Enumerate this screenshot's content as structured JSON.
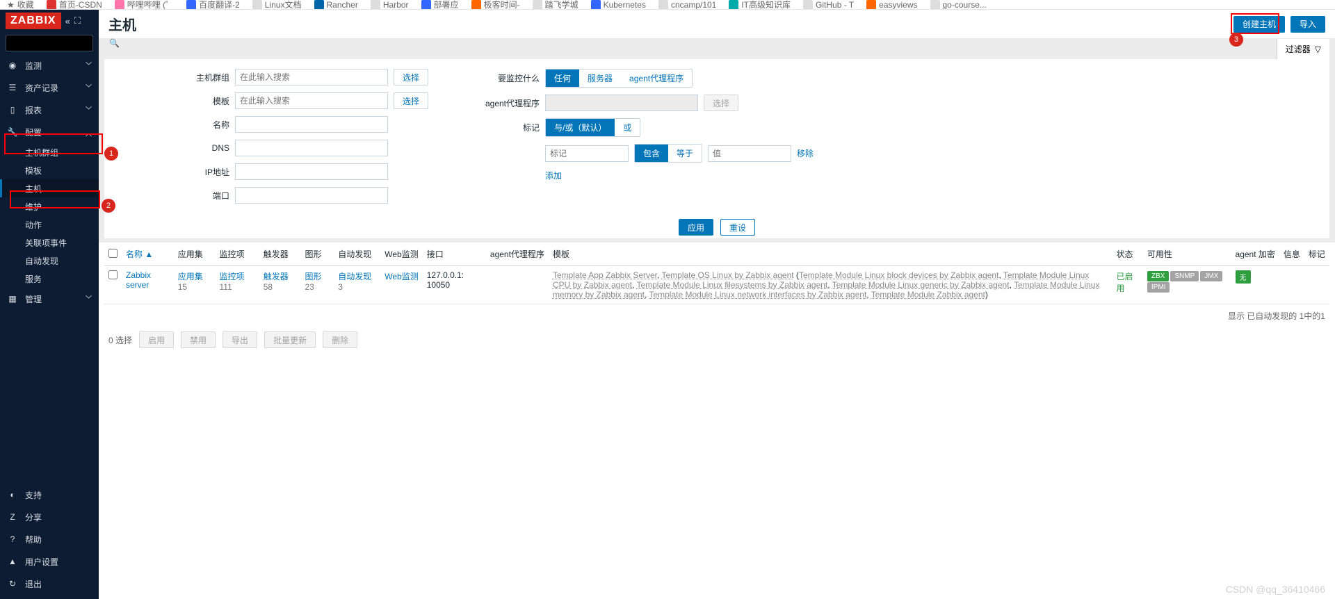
{
  "bookmarks": [
    "收藏",
    "首页-CSDN",
    "哔哩哔哩 (゜",
    "百度翻译-2",
    "Linux文档",
    "Rancher",
    "Harbor",
    "部署应",
    "极客时间-",
    "踏飞学城",
    "Kubernetes",
    "cncamp/101",
    "IT高级知识库",
    "GitHub - T",
    "easyviews",
    "go-course..."
  ],
  "logo": "ZABBIX",
  "search_placeholder": "",
  "nav": {
    "main": [
      {
        "icon": "◎",
        "label": "监测"
      },
      {
        "icon": "≡",
        "label": "资产记录"
      },
      {
        "icon": "▮",
        "label": "报表"
      },
      {
        "icon": "🔧",
        "label": "配置"
      }
    ],
    "config_sub": [
      "主机群组",
      "模板",
      "主机",
      "维护",
      "动作",
      "关联项事件",
      "自动发现",
      "服务"
    ],
    "admin": {
      "icon": "▦",
      "label": "管理"
    },
    "bottom": [
      {
        "icon": "◑",
        "label": "支持"
      },
      {
        "icon": "Z",
        "label": "分享"
      },
      {
        "icon": "?",
        "label": "帮助"
      },
      {
        "icon": "▲",
        "label": "用户设置"
      },
      {
        "icon": "↻",
        "label": "退出"
      }
    ]
  },
  "page": {
    "title": "主机",
    "create": "创建主机",
    "import": "导入"
  },
  "filter": {
    "tab": "过滤器",
    "labels": {
      "hostgroup": "主机群组",
      "template": "模板",
      "name": "名称",
      "dns": "DNS",
      "ip": "IP地址",
      "port": "端口",
      "monitor": "要监控什么",
      "proxy": "agent代理程序",
      "tags": "标记"
    },
    "placeholder": "在此输入搜索",
    "select": "选择",
    "mon_opts": [
      "任何",
      "服务器",
      "agent代理程序"
    ],
    "tag_mode": [
      "与/或（默认）",
      "或"
    ],
    "tag_ph": "标记",
    "tag_op": [
      "包含",
      "等于"
    ],
    "tag_val_ph": "值",
    "tag_remove": "移除",
    "tag_add": "添加",
    "apply": "应用",
    "reset": "重设"
  },
  "table": {
    "cols": [
      "",
      "名称 ▲",
      "应用集",
      "监控项",
      "触发器",
      "图形",
      "自动发现",
      "Web监测",
      "接口",
      "agent代理程序",
      "模板",
      "状态",
      "可用性",
      "agent 加密",
      "信息",
      "标记"
    ],
    "row": {
      "name": "Zabbix server",
      "apps": "应用集",
      "apps_n": "15",
      "items": "监控项",
      "items_n": "111",
      "trig": "触发器",
      "trig_n": "58",
      "graph": "图形",
      "graph_n": "23",
      "disc": "自动发现",
      "disc_n": "3",
      "web": "Web监测",
      "iface": "127.0.0.1: 10050",
      "tpl_plain": [
        "Template App Zabbix Server",
        ", ",
        "Template OS Linux by Zabbix agent",
        " ("
      ],
      "tpl_dashed": [
        "Template Module Linux block devices by Zabbix agent",
        "Template Module Linux CPU by Zabbix agent",
        "Template Module Linux filesystems by Zabbix agent",
        "Template Module Linux generic by Zabbix agent",
        "Template Module Linux memory by Zabbix agent",
        "Template Module Linux network interfaces by Zabbix agent",
        "Template Module Zabbix agent"
      ],
      "tpl_close": ")",
      "status": "已启用",
      "avail": [
        "ZBX",
        "SNMP",
        "JMX",
        "IPMI"
      ],
      "enc": "无"
    },
    "footer": "显示 已自动发现的 1中的1"
  },
  "bulk": {
    "sel": "0 选择",
    "btns": [
      "启用",
      "禁用",
      "导出",
      "批量更新",
      "删除"
    ]
  },
  "watermark": "CSDN @qq_36410466",
  "badges": {
    "b1": "1",
    "b2": "2",
    "b3": "3"
  }
}
